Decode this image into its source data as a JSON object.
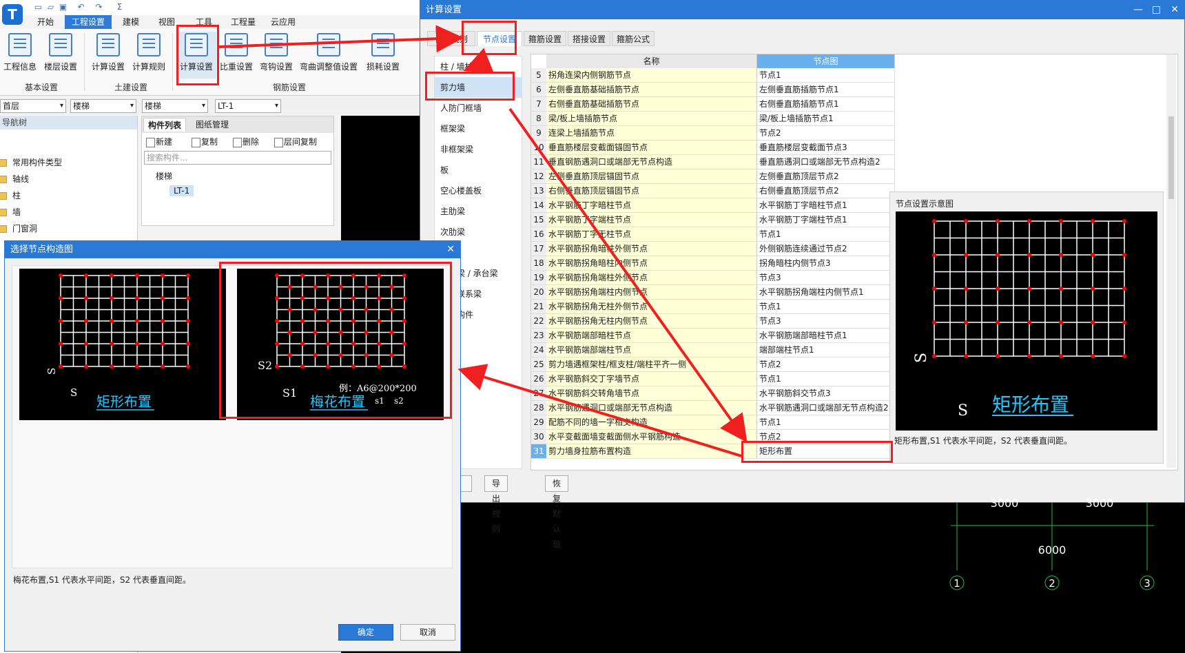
{
  "app": {
    "logo": "T",
    "ribbon_tabs": [
      "开始",
      "工程设置",
      "建模",
      "视图",
      "工具",
      "工程量",
      "云应用"
    ],
    "active_tab": "工程设置",
    "ribbon_buttons": [
      "工程信息",
      "楼层设置",
      "计算设置",
      "计算规则",
      "计算设置",
      "比重设置",
      "弯钩设置",
      "弯曲调整值设置",
      "损耗设置"
    ],
    "groups": [
      "基本设置",
      "土建设置",
      "钢筋设置"
    ],
    "combos": [
      "首层",
      "楼梯",
      "楼梯",
      "LT-1"
    ],
    "nav_title": "导航树",
    "nav_items": [
      "常用构件类型",
      "轴线",
      "柱",
      "墙",
      "门窗洞"
    ],
    "comp_tabs": [
      "构件列表",
      "图纸管理"
    ],
    "comp_tools": [
      "新建",
      "复制",
      "删除",
      "层间复制"
    ],
    "search_placeholder": "搜索构件...",
    "tree_parent": "楼梯",
    "tree_child": "LT-1"
  },
  "dialog_left": {
    "title": "选择节点构造图",
    "thumb1_caption": "矩形布置",
    "thumb2_caption": "梅花布置",
    "thumb2_example": "例：A6@200*200",
    "desc": "梅花布置,S1 代表水平间距，S2 代表垂直间距。",
    "ok": "确定",
    "cancel": "取消"
  },
  "dialog_right": {
    "title": "计算设置",
    "tabs": [
      "计算规则",
      "节点设置",
      "箍筋设置",
      "搭接设置",
      "箍筋公式"
    ],
    "active_tab": "节点设置",
    "categories": [
      "柱 / 墙柱",
      "剪力墙",
      "人防门框墙",
      "框架梁",
      "非框架梁",
      "板",
      "空心楼盖板",
      "主肋梁",
      "次肋梁",
      "基础梁 / 承台梁",
      "基础联系梁",
      "其他构件"
    ],
    "selected_category": "剪力墙",
    "col_name": "名称",
    "col_node": "节点图",
    "rows": [
      {
        "n": "5",
        "name": "拐角连梁内侧钢筋节点",
        "val": "节点1"
      },
      {
        "n": "6",
        "name": "左侧垂直筋基础插筋节点",
        "val": "左侧垂直筋插筋节点1"
      },
      {
        "n": "7",
        "name": "右侧垂直筋基础插筋节点",
        "val": "右侧垂直筋插筋节点1"
      },
      {
        "n": "8",
        "name": "梁/板上墙插筋节点",
        "val": "梁/板上墙插筋节点1"
      },
      {
        "n": "9",
        "name": "连梁上墙插筋节点",
        "val": "节点2"
      },
      {
        "n": "10",
        "name": "垂直筋楼层变截面锚固节点",
        "val": "垂直筋楼层变截面节点3"
      },
      {
        "n": "11",
        "name": "垂直钢筋遇洞口或端部无节点构造",
        "val": "垂直筋遇洞口或端部无节点构造2"
      },
      {
        "n": "12",
        "name": "左侧垂直筋顶层锚固节点",
        "val": "左侧垂直筋顶层节点2"
      },
      {
        "n": "13",
        "name": "右侧垂直筋顶层锚固节点",
        "val": "右侧垂直筋顶层节点2"
      },
      {
        "n": "14",
        "name": "水平钢筋丁字暗柱节点",
        "val": "水平钢筋丁字暗柱节点1"
      },
      {
        "n": "15",
        "name": "水平钢筋丁字端柱节点",
        "val": "水平钢筋丁字端柱节点1"
      },
      {
        "n": "16",
        "name": "水平钢筋丁字无柱节点",
        "val": "节点1"
      },
      {
        "n": "17",
        "name": "水平钢筋拐角暗柱外侧节点",
        "val": "外侧钢筋连续通过节点2"
      },
      {
        "n": "18",
        "name": "水平钢筋拐角暗柱内侧节点",
        "val": "拐角暗柱内侧节点3"
      },
      {
        "n": "19",
        "name": "水平钢筋拐角端柱外侧节点",
        "val": "节点3"
      },
      {
        "n": "20",
        "name": "水平钢筋拐角端柱内侧节点",
        "val": "水平钢筋拐角端柱内侧节点1"
      },
      {
        "n": "21",
        "name": "水平钢筋拐角无柱外侧节点",
        "val": "节点1"
      },
      {
        "n": "22",
        "name": "水平钢筋拐角无柱内侧节点",
        "val": "节点3"
      },
      {
        "n": "23",
        "name": "水平钢筋端部暗柱节点",
        "val": "水平钢筋端部暗柱节点1"
      },
      {
        "n": "24",
        "name": "水平钢筋端部端柱节点",
        "val": "端部端柱节点1"
      },
      {
        "n": "25",
        "name": "剪力墙遇框架柱/框支柱/端柱平齐一侧",
        "val": "节点2"
      },
      {
        "n": "26",
        "name": "水平钢筋斜交丁字墙节点",
        "val": "节点1"
      },
      {
        "n": "27",
        "name": "水平钢筋斜交转角墙节点",
        "val": "水平钢筋斜交节点3"
      },
      {
        "n": "28",
        "name": "水平钢筋遇洞口或端部无节点构造",
        "val": "水平钢筋遇洞口或端部无节点构造2"
      },
      {
        "n": "29",
        "name": "配筋不同的墙一字相交构造",
        "val": "节点1"
      },
      {
        "n": "30",
        "name": "水平变截面墙变截面侧水平钢筋构造",
        "val": "节点2"
      },
      {
        "n": "31",
        "name": "剪力墙身拉筋布置构造",
        "val": "矩形布置"
      }
    ],
    "preview_title": "节点设置示意图",
    "preview_caption": "矩形布置",
    "preview_desc": "矩形布置,S1 代表水平间距，S2 代表垂直间距。",
    "foot_buttons": [
      "导入规则",
      "导出规则",
      "恢复默认值"
    ]
  },
  "canvas": {
    "dims": [
      "3000",
      "3000",
      "6000"
    ],
    "axes": [
      "1",
      "2",
      "3"
    ]
  }
}
